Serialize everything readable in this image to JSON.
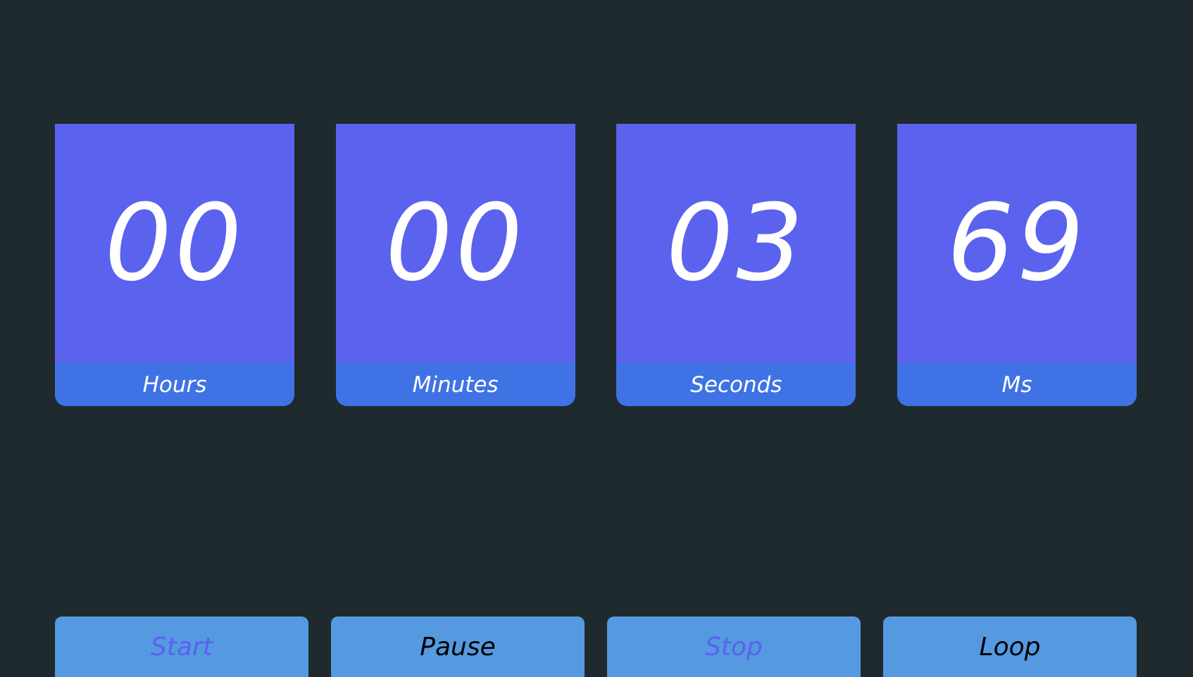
{
  "colors": {
    "background": "#1e2a2d",
    "card_face": "#5a62ee",
    "card_label_bar": "#3f73e5",
    "button_bg": "#5599e0",
    "active_text": "#000000",
    "disabled_text": "#5a62ee",
    "digit_text": "#ffffff"
  },
  "timer": {
    "units": [
      {
        "value": "00",
        "label": "Hours"
      },
      {
        "value": "00",
        "label": "Minutes"
      },
      {
        "value": "03",
        "label": "Seconds"
      },
      {
        "value": "69",
        "label": "Ms"
      }
    ]
  },
  "controls": {
    "buttons": [
      {
        "label": "Start",
        "state": "disabled"
      },
      {
        "label": "Pause",
        "state": "enabled"
      },
      {
        "label": "Stop",
        "state": "disabled"
      },
      {
        "label": "Loop",
        "state": "enabled"
      }
    ]
  }
}
